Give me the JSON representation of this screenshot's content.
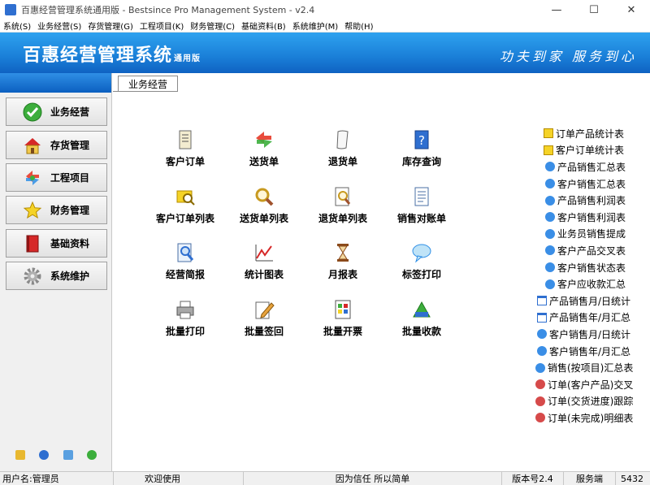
{
  "window": {
    "title": "百惠经营管理系统通用版 - Bestsince Pro Management System - v2.4",
    "controls": [
      "—",
      "☐",
      "✕"
    ]
  },
  "menu": [
    "系统(S)",
    "业务经营(S)",
    "存货管理(G)",
    "工程项目(K)",
    "财务管理(C)",
    "基础资料(B)",
    "系统维护(M)",
    "帮助(H)"
  ],
  "banner": {
    "product": "百惠经营管理系统",
    "edition": "通用版",
    "slogan": "功夫到家 服务到心"
  },
  "sidebar": {
    "items": [
      {
        "label": "业务经营",
        "icon": "check-circle-icon"
      },
      {
        "label": "存货管理",
        "icon": "house-icon"
      },
      {
        "label": "工程项目",
        "icon": "cycle-arrows-icon"
      },
      {
        "label": "财务管理",
        "icon": "star-icon"
      },
      {
        "label": "基础资料",
        "icon": "book-icon"
      },
      {
        "label": "系统维护",
        "icon": "gear-icon"
      }
    ],
    "tools": [
      "key-icon",
      "clock-icon",
      "window-icon",
      "refresh-icon"
    ]
  },
  "tab": {
    "label": "业务经营"
  },
  "functions": [
    {
      "label": "客户订单",
      "icon": "scroll-icon"
    },
    {
      "label": "送货单",
      "icon": "cycle-arrows-icon"
    },
    {
      "label": "退货单",
      "icon": "paper-roll-icon"
    },
    {
      "label": "库存查询",
      "icon": "question-book-icon"
    },
    {
      "label": "客户订单列表",
      "icon": "folder-search-icon"
    },
    {
      "label": "送货单列表",
      "icon": "magnifier-icon"
    },
    {
      "label": "退货单列表",
      "icon": "doc-search-icon"
    },
    {
      "label": "销售对账单",
      "icon": "document-icon"
    },
    {
      "label": "经营简报",
      "icon": "report-search-icon"
    },
    {
      "label": "统计图表",
      "icon": "line-chart-icon"
    },
    {
      "label": "月报表",
      "icon": "hourglass-icon"
    },
    {
      "label": "标签打印",
      "icon": "speech-bubble-icon"
    },
    {
      "label": "批量打印",
      "icon": "printer-icon"
    },
    {
      "label": "批量签回",
      "icon": "pen-edit-icon"
    },
    {
      "label": "批量开票",
      "icon": "invoice-icon"
    },
    {
      "label": "批量收款",
      "icon": "money-icon"
    }
  ],
  "reports": [
    {
      "label": "订单产品统计表",
      "icon": "folder-icon"
    },
    {
      "label": "客户订单统计表",
      "icon": "folder-icon"
    },
    {
      "label": "产品销售汇总表",
      "icon": "globe-icon"
    },
    {
      "label": "客户销售汇总表",
      "icon": "globe-icon"
    },
    {
      "label": "产品销售利润表",
      "icon": "globe-icon"
    },
    {
      "label": "客户销售利润表",
      "icon": "globe-icon"
    },
    {
      "label": "业务员销售提成",
      "icon": "globe-icon"
    },
    {
      "label": "客户产品交叉表",
      "icon": "globe-icon"
    },
    {
      "label": "客户销售状态表",
      "icon": "globe-icon"
    },
    {
      "label": "客户应收款汇总",
      "icon": "globe-icon"
    },
    {
      "label": "产品销售月/日统计",
      "icon": "window-icon"
    },
    {
      "label": "产品销售年/月汇总",
      "icon": "window-icon"
    },
    {
      "label": "客户销售月/日统计",
      "icon": "globe-icon"
    },
    {
      "label": "客户销售年/月汇总",
      "icon": "globe-icon"
    },
    {
      "label": "销售(按项目)汇总表",
      "icon": "globe-icon"
    },
    {
      "label": "订单(客户产品)交叉",
      "icon": "red-globe-icon"
    },
    {
      "label": "订单(交货进度)跟踪",
      "icon": "red-globe-icon"
    },
    {
      "label": "订单(未完成)明细表",
      "icon": "red-globe-icon"
    }
  ],
  "status": {
    "user": "用户名:管理员",
    "welcome": "欢迎使用",
    "motto": "因为信任 所以简单",
    "version": "版本号2.4",
    "server": "服务端",
    "code": "5432"
  },
  "colors": {
    "banner": "#1a7fd8",
    "accent_green": "#3cae3c",
    "accent_red": "#d62828"
  }
}
